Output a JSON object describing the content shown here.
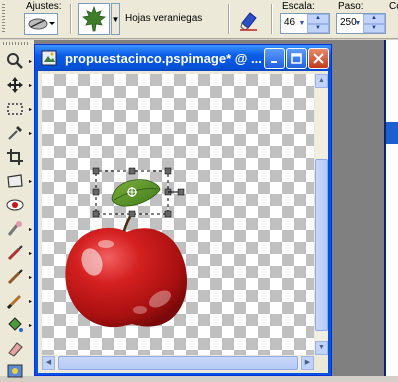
{
  "options_bar": {
    "presets_label": "Ajustes:",
    "leaf_name": "Hojas veraniegas",
    "scale_label": "Escala:",
    "scale_value": "46",
    "step_label": "Paso:",
    "step_value": "250",
    "color_label": "Co"
  },
  "document": {
    "title": "propuestacinco.pspimage* @ ..."
  },
  "icons": {
    "preset": "brush-preset-icon",
    "leaf": "maple-leaf-icon",
    "eraser": "eraser-icon",
    "tools": [
      "zoom-icon",
      "move-icon",
      "selection-icon",
      "dropper-icon",
      "crop-icon",
      "deform-icon",
      "red-eye-icon",
      "makeover-icon",
      "clone-icon",
      "retouch-icon",
      "brush-icon",
      "fill-icon",
      "eraser-tool-icon",
      "picture-tube-icon"
    ]
  },
  "colors": {
    "titlebar": "#0a5ce7",
    "workspace": "#808080",
    "apple_red": "#c81a1a"
  }
}
